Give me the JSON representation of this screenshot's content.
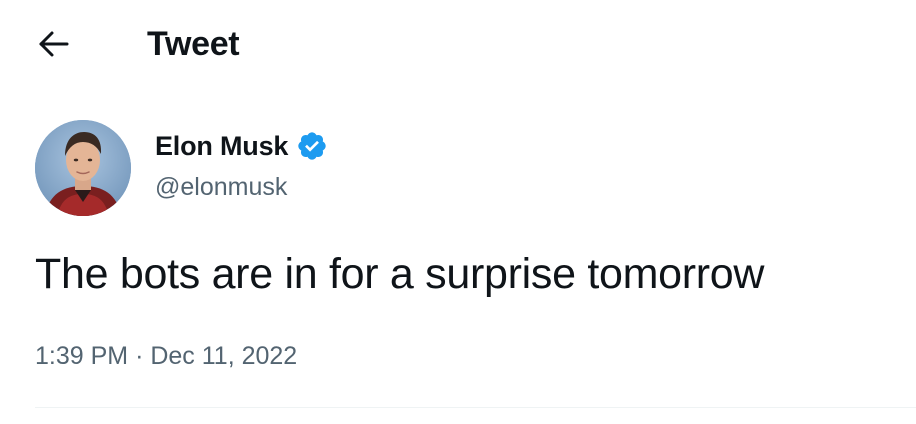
{
  "header": {
    "back_icon": "arrow-left-icon",
    "title": "Tweet"
  },
  "author": {
    "name": "Elon Musk",
    "handle": "@elonmusk",
    "verified_icon": "verified-badge-icon",
    "verified_color": "#1d9bf0"
  },
  "tweet": {
    "text": "The bots are in for a surprise tomorrow",
    "time": "1:39 PM",
    "separator": "·",
    "date": "Dec 11, 2022"
  },
  "colors": {
    "text_primary": "#0f1419",
    "text_secondary": "#536471",
    "divider": "#eff3f4"
  }
}
